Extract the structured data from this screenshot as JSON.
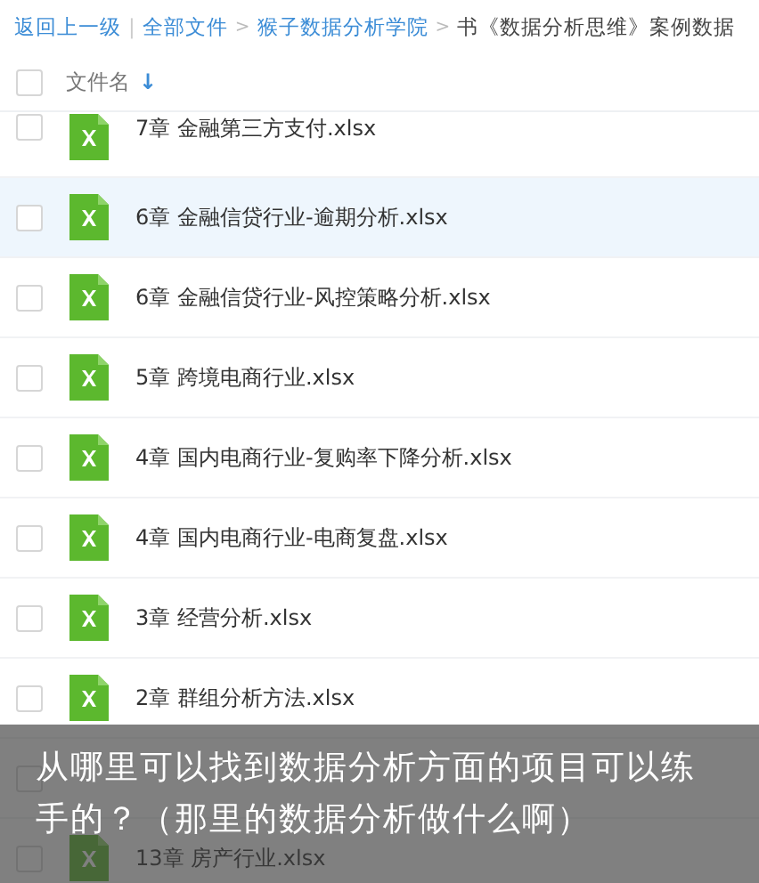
{
  "breadcrumb": [
    {
      "kind": "link",
      "text": "返回上一级"
    },
    {
      "kind": "divider",
      "text": "|"
    },
    {
      "kind": "link",
      "text": "全部文件"
    },
    {
      "kind": "separator",
      "text": ">"
    },
    {
      "kind": "link",
      "text": "猴子数据分析学院"
    },
    {
      "kind": "separator",
      "text": ">"
    },
    {
      "kind": "current",
      "text": "书《数据分析思维》案例数据"
    }
  ],
  "header": {
    "label": "文件名",
    "sort_icon": "↓",
    "checked": false
  },
  "files": [
    {
      "name": "7章 金融第三方支付.xlsx",
      "selected": false,
      "checked": false
    },
    {
      "name": "6章 金融信贷行业-逾期分析.xlsx",
      "selected": true,
      "checked": false
    },
    {
      "name": "6章 金融信贷行业-风控策略分析.xlsx",
      "selected": false,
      "checked": false
    },
    {
      "name": "5章 跨境电商行业.xlsx",
      "selected": false,
      "checked": false
    },
    {
      "name": "4章 国内电商行业-复购率下降分析.xlsx",
      "selected": false,
      "checked": false
    },
    {
      "name": "4章 国内电商行业-电商复盘.xlsx",
      "selected": false,
      "checked": false
    },
    {
      "name": "3章 经营分析.xlsx",
      "selected": false,
      "checked": false
    },
    {
      "name": "2章 群组分析方法.xlsx",
      "selected": false,
      "checked": false
    },
    {
      "checked": false
    },
    {
      "name": "13章 房产行业.xlsx",
      "checked": false
    }
  ],
  "caption": "从哪里可以找到数据分析方面的项目可以练手的？（那里的数据分析做什么啊）"
}
